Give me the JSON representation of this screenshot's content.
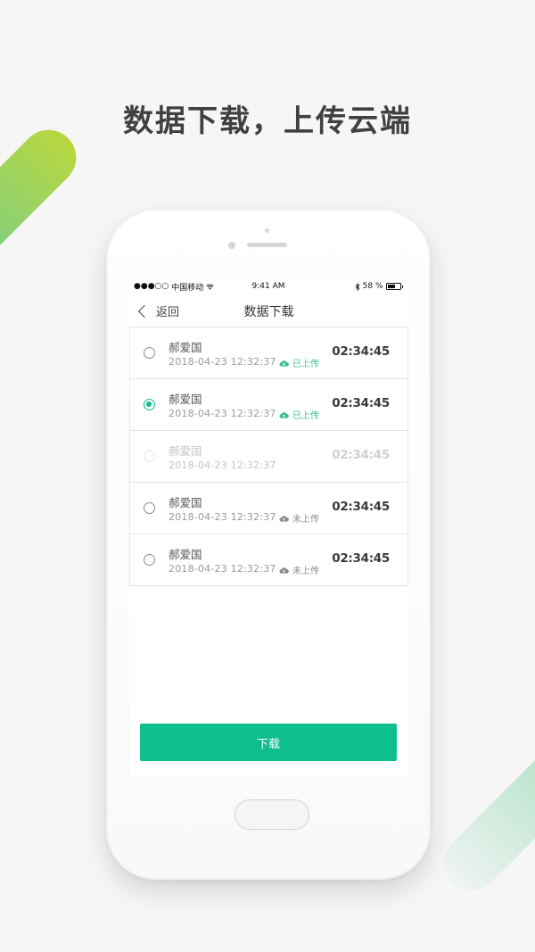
{
  "headline": "数据下载，上传云端",
  "status_bar": {
    "signal": "●●●○○",
    "carrier": "中国移动",
    "time": "9:41 AM",
    "battery_pct": "58 %"
  },
  "navbar": {
    "back_label": "返回",
    "title": "数据下载"
  },
  "records": [
    {
      "name": "郝爱国",
      "date": "2018-04-23 12:32:37",
      "upload_status": "已上传",
      "uploaded": true,
      "time": "02:34:45",
      "checked": false,
      "disabled": false
    },
    {
      "name": "郝爱国",
      "date": "2018-04-23 12:32:37",
      "upload_status": "已上传",
      "uploaded": true,
      "time": "02:34:45",
      "checked": true,
      "disabled": false
    },
    {
      "name": "郝爱国",
      "date": "2018-04-23 12:32:37",
      "upload_status": "",
      "uploaded": false,
      "time": "02:34:45",
      "checked": false,
      "disabled": true
    },
    {
      "name": "郝爱国",
      "date": "2018-04-23 12:32:37",
      "upload_status": "未上传",
      "uploaded": false,
      "time": "02:34:45",
      "checked": false,
      "disabled": false
    },
    {
      "name": "郝爱国",
      "date": "2018-04-23 12:32:37",
      "upload_status": "未上传",
      "uploaded": false,
      "time": "02:34:45",
      "checked": false,
      "disabled": false
    }
  ],
  "download_label": "下载",
  "colors": {
    "accent": "#0cbf8c",
    "uploaded": "#3bbf94",
    "pending": "#8d8d8d"
  }
}
